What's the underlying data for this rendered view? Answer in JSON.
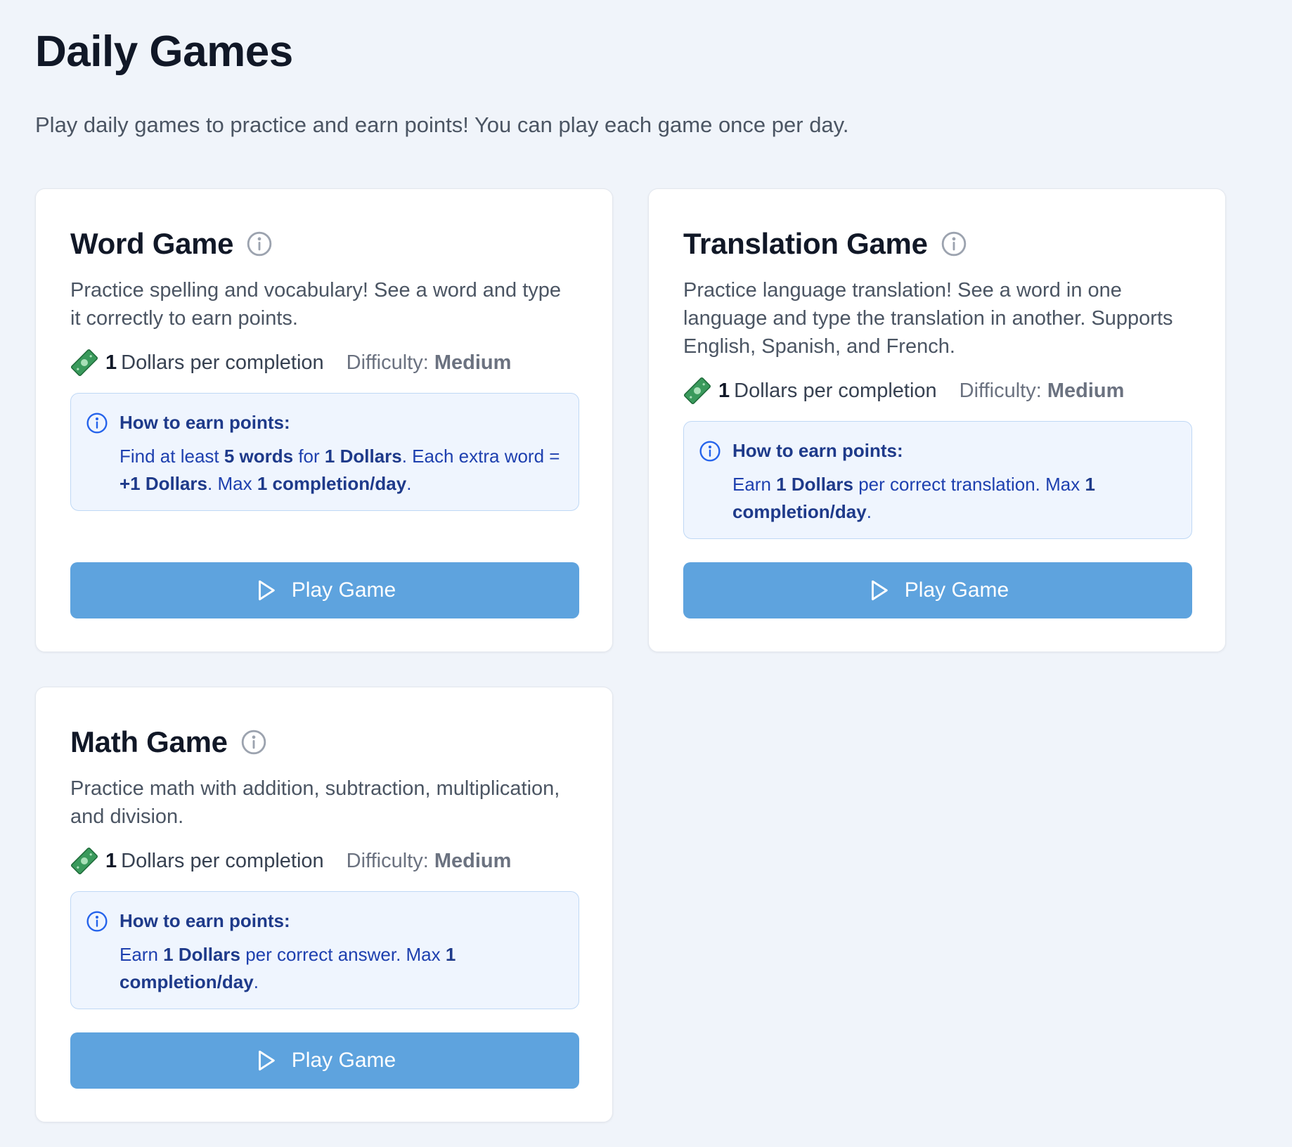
{
  "header": {
    "title": "Daily Games",
    "subtitle": "Play daily games to practice and earn points! You can play each game once per day."
  },
  "colors": {
    "page_bg": "#f0f4fa",
    "button_bg": "#5ea3de",
    "howto_bg": "#eff5fe",
    "howto_border": "#bfd8f5",
    "howto_text": "#1e40af",
    "money_icon": "#2f9e5a"
  },
  "games": [
    {
      "title": "Word Game",
      "description": "Practice spelling and vocabulary! See a word and type it correctly to earn points.",
      "reward_amount": "1",
      "reward_text": "Dollars per completion",
      "difficulty_label": "Difficulty:",
      "difficulty_value": "Medium",
      "howto_title": "How to earn points:",
      "howto_parts": [
        "Find at least ",
        "5 words",
        " for ",
        "1 Dollars",
        ". Each extra word = ",
        "+1 Dollars",
        ". Max ",
        "1 completion/day",
        "."
      ],
      "play_label": "Play Game"
    },
    {
      "title": "Translation Game",
      "description": "Practice language translation! See a word in one language and type the translation in another. Supports English, Spanish, and French.",
      "reward_amount": "1",
      "reward_text": "Dollars per completion",
      "difficulty_label": "Difficulty:",
      "difficulty_value": "Medium",
      "howto_title": "How to earn points:",
      "howto_parts": [
        "Earn ",
        "1 Dollars",
        " per correct translation. Max ",
        "1 completion/day",
        "."
      ],
      "play_label": "Play Game"
    },
    {
      "title": "Math Game",
      "description": "Practice math with addition, subtraction, multiplication, and division.",
      "reward_amount": "1",
      "reward_text": "Dollars per completion",
      "difficulty_label": "Difficulty:",
      "difficulty_value": "Medium",
      "howto_title": "How to earn points:",
      "howto_parts": [
        "Earn ",
        "1 Dollars",
        " per correct answer. Max ",
        "1 completion/day",
        "."
      ],
      "play_label": "Play Game"
    }
  ]
}
